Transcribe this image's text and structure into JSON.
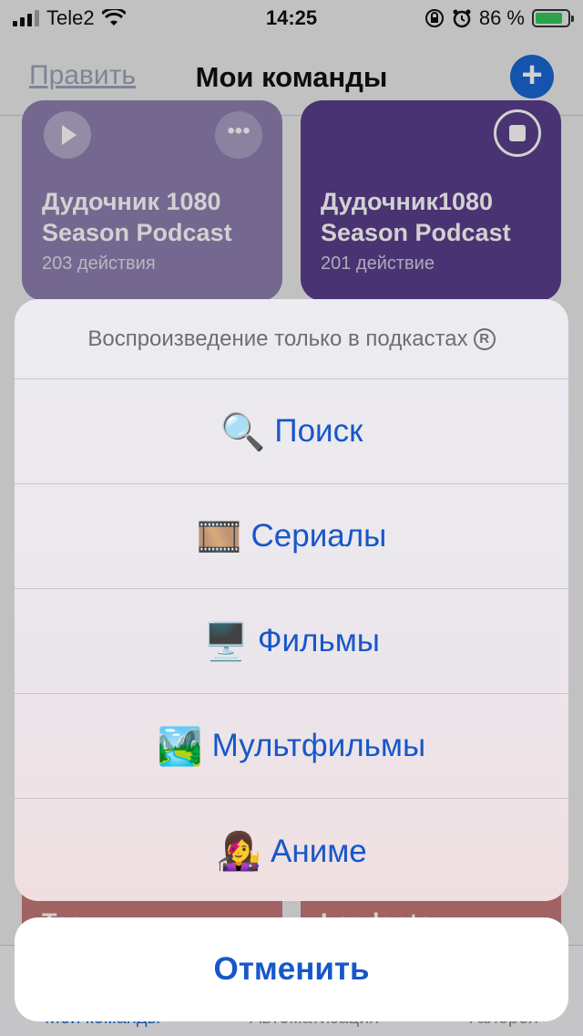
{
  "status_bar": {
    "carrier": "Tele2",
    "time": "14:25",
    "battery_percent": "86 %",
    "battery_level": 0.86,
    "icons": [
      "signal-icon",
      "wifi-icon",
      "rotation-lock-icon",
      "alarm-icon",
      "battery-charging-icon"
    ]
  },
  "nav": {
    "edit_label": "Править",
    "title": "Мои команды",
    "add_label": "+"
  },
  "cards": [
    {
      "title": "Дудочник 1080 Season Podcast",
      "subtitle": "203 действия",
      "color": "#8e7fb1"
    },
    {
      "title": "Дудочник1080 Season Podcast",
      "subtitle": "201 действие",
      "color": "#5a3f8c"
    },
    {
      "title": "Тест",
      "color": "#c47878"
    },
    {
      "title": "Loader to",
      "color": "#c47878"
    }
  ],
  "card_more_label": "•••",
  "tabs": [
    {
      "label": "Мои команды",
      "active": true
    },
    {
      "label": "Автоматизация",
      "active": false
    },
    {
      "label": "Галерея",
      "active": false
    }
  ],
  "sheet": {
    "header": "Воспроизведение только в подкастах",
    "header_symbol": "R",
    "options": [
      {
        "label": "Поиск",
        "icon": "magnifier-icon",
        "glyph": "🔍"
      },
      {
        "label": "Сериалы",
        "icon": "film-strip-icon",
        "glyph": "🎞️"
      },
      {
        "label": "Фильмы",
        "icon": "desktop-computer-icon",
        "glyph": "🖥️"
      },
      {
        "label": "Мультфильмы",
        "icon": "landscape-picture-icon",
        "glyph": "🏞️"
      },
      {
        "label": "Аниме",
        "icon": "woman-singer-icon",
        "glyph": "👩‍🎤"
      }
    ]
  },
  "cancel_label": "Отменить",
  "colors": {
    "accent": "#1757c9",
    "add_button": "#1a67d4"
  }
}
